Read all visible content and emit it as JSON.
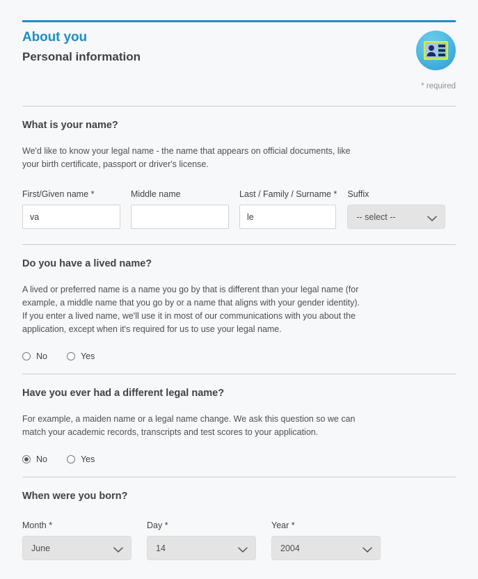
{
  "header": {
    "eyebrow": "About you",
    "title": "Personal information",
    "badge_icon": "id-card-icon",
    "required_note": "* required",
    "accent_color": "#1d8ecb"
  },
  "sections": {
    "name": {
      "question": "What is your name?",
      "description": "We'd like to know your legal name - the name that appears on official documents, like your birth certificate, passport or driver's license.",
      "fields": [
        {
          "label": "First/Given name *",
          "value": "va",
          "placeholder": ""
        },
        {
          "label": "Middle name",
          "value": "",
          "placeholder": ""
        },
        {
          "label": "Last / Family / Surname *",
          "value": "le",
          "placeholder": ""
        },
        {
          "label": "Suffix",
          "value": "-- select --",
          "placeholder": ""
        }
      ]
    },
    "lived_name": {
      "question": "Do you have a lived name?",
      "description": "A lived or preferred name is a name you go by that is different than your legal name (for example, a middle name that you go by or a name that aligns with your gender identity). If you enter a lived name, we'll use it in most of our communications with you about the application, except when it's required for us to use your legal name.",
      "options": [
        {
          "label": "No",
          "selected": false
        },
        {
          "label": "Yes",
          "selected": false
        }
      ]
    },
    "legal_name": {
      "question": "Have you ever had a different legal name?",
      "description": "For example, a maiden name or a legal name change. We ask this question so we can match your academic records, transcripts and test scores to your application.",
      "options": [
        {
          "label": "No",
          "selected": true
        },
        {
          "label": "Yes",
          "selected": false
        }
      ]
    },
    "dob": {
      "question": "When were you born?",
      "fields": [
        {
          "label": "Month *",
          "value": "June"
        },
        {
          "label": "Day *",
          "value": "14"
        },
        {
          "label": "Year *",
          "value": "2004"
        }
      ]
    }
  }
}
